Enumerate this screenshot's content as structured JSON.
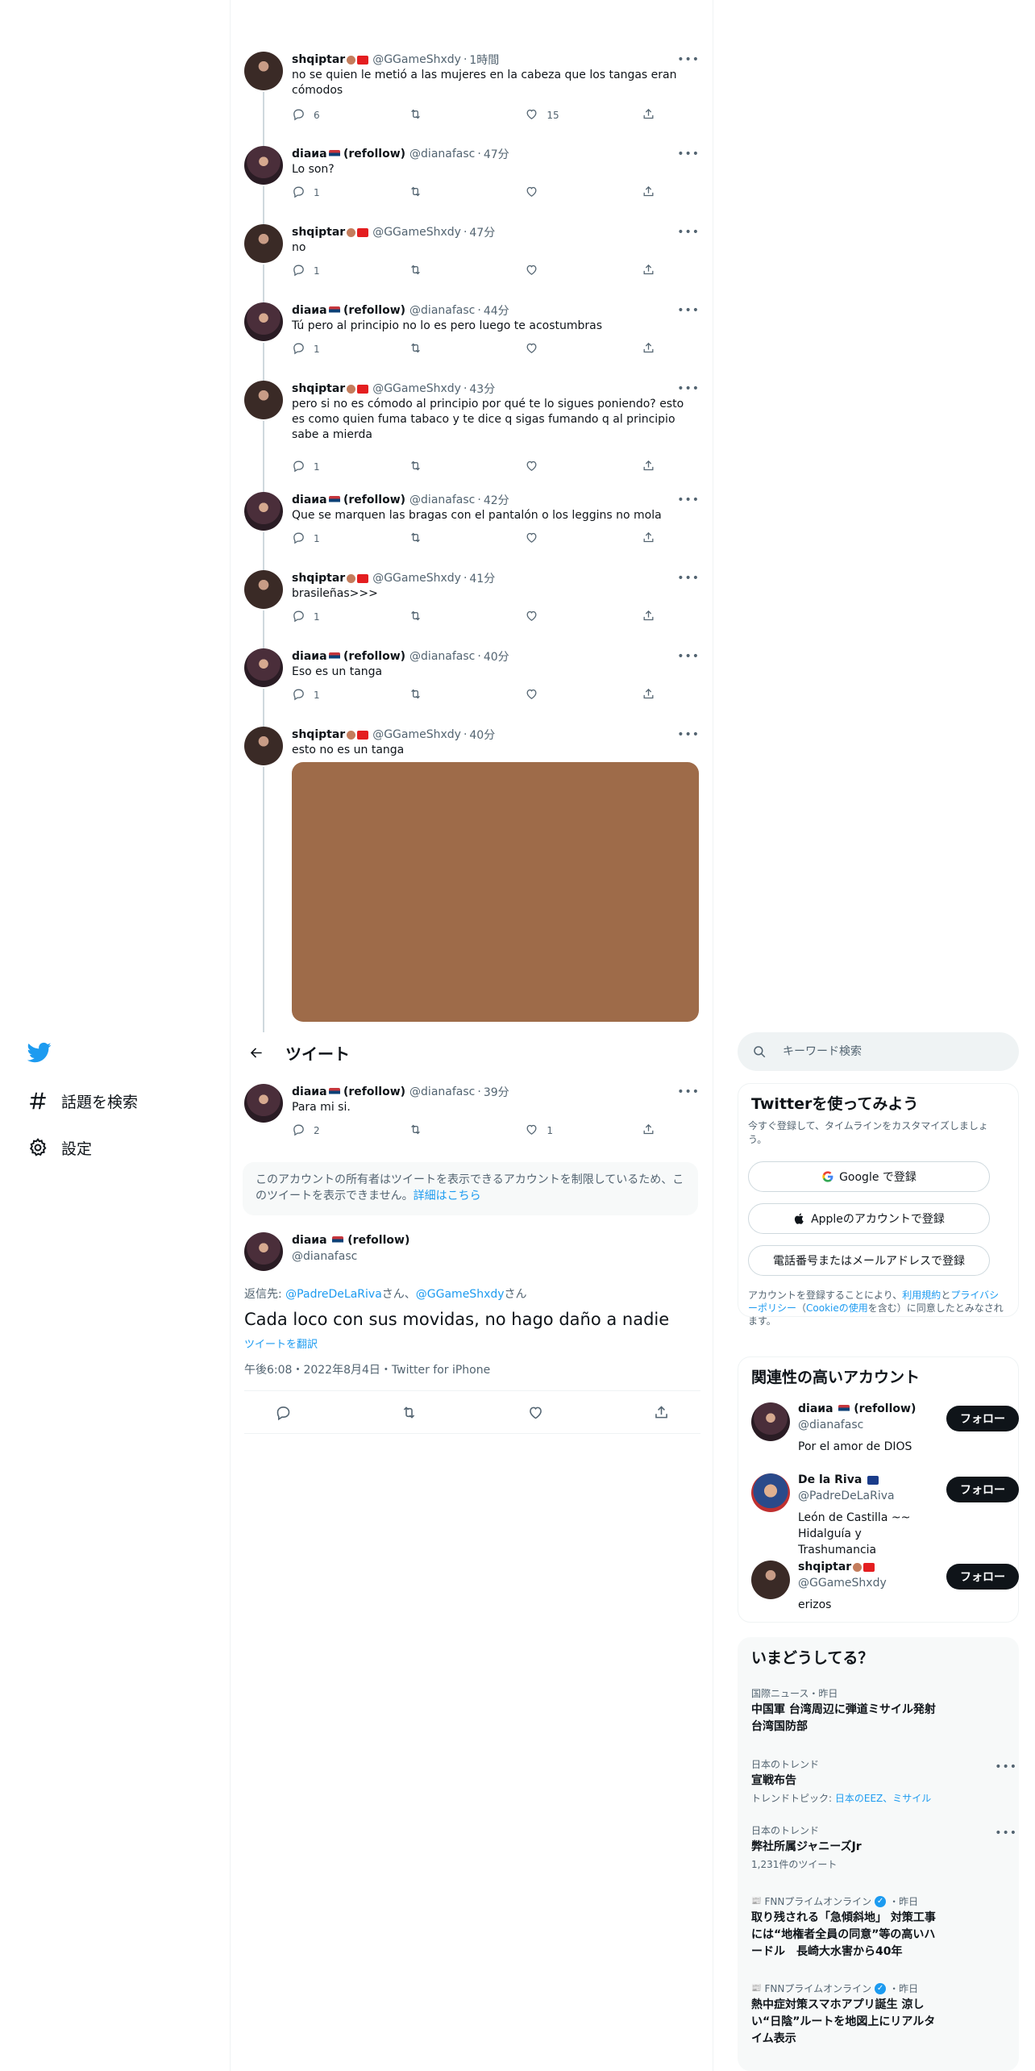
{
  "nav": {
    "items": [
      {
        "label": "話題を検索",
        "icon": "hashtag-icon"
      },
      {
        "label": "設定",
        "icon": "gear-icon"
      }
    ]
  },
  "header": {
    "title": "ツイート"
  },
  "thread": [
    {
      "name": "shqiptar",
      "handle": "@GGameShxdy",
      "time": "1時間",
      "text": "no se quien le metió a las mujeres en la cabeza que los tangas eran cómodos",
      "replies": "6",
      "retweets": "",
      "likes": "15"
    },
    {
      "name": "diaиa",
      "extra": "(refollow)",
      "handle": "@dianafasc",
      "time": "47分",
      "text": "Lo son?",
      "replies": "1",
      "retweets": "",
      "likes": ""
    },
    {
      "name": "shqiptar",
      "handle": "@GGameShxdy",
      "time": "47分",
      "text": "no",
      "replies": "1",
      "retweets": "",
      "likes": ""
    },
    {
      "name": "diaиa",
      "extra": "(refollow)",
      "handle": "@dianafasc",
      "time": "44分",
      "text": "Tú pero al principio no lo es pero luego te acostumbras",
      "replies": "1",
      "retweets": "",
      "likes": ""
    },
    {
      "name": "shqiptar",
      "handle": "@GGameShxdy",
      "time": "43分",
      "text": "pero si no es cómodo al principio por qué te lo sigues poniendo? esto es como quien fuma tabaco y te dice q sigas fumando q al principio sabe a mierda",
      "replies": "1",
      "retweets": "",
      "likes": ""
    },
    {
      "name": "diaиa",
      "extra": "(refollow)",
      "handle": "@dianafasc",
      "time": "42分",
      "text": "Que se marquen las bragas con el pantalón o los leggins no mola",
      "replies": "1",
      "retweets": "",
      "likes": ""
    },
    {
      "name": "shqiptar",
      "handle": "@GGameShxdy",
      "time": "41分",
      "text": "brasileñas>>>",
      "replies": "1",
      "retweets": "",
      "likes": ""
    },
    {
      "name": "diaиa",
      "extra": "(refollow)",
      "handle": "@dianafasc",
      "time": "40分",
      "text": "Eso es un tanga",
      "replies": "1",
      "retweets": "",
      "likes": ""
    },
    {
      "name": "shqiptar",
      "handle": "@GGameShxdy",
      "time": "40分",
      "text": "esto no es un tanga"
    },
    {
      "name": "diaиa",
      "extra": "(refollow)",
      "handle": "@dianafasc",
      "time": "39分",
      "text": "Para mi si.",
      "replies": "2",
      "retweets": "",
      "likes": "1"
    }
  ],
  "restricted": {
    "text": "このアカウントの所有者はツイートを表示できるアカウントを制限しているため、このツイートを表示できません。",
    "link": "詳細はこちら"
  },
  "main_tweet": {
    "name": "diaиa",
    "extra": "(refollow)",
    "handle": "@dianafasc",
    "reply_prefix": "返信先: ",
    "reply_to_1": "@PadreDeLaRiva",
    "reply_suffix_1": "さん、",
    "reply_to_2": "@GGameShxdy",
    "reply_suffix_2": "さん",
    "text": "Cada loco con sus movidas, no hago daño a nadie",
    "translate": "ツイートを翻訳",
    "time": "午後6:08",
    "date": "2022年8月4日",
    "source": "Twitter for iPhone",
    "sep": "・"
  },
  "search": {
    "placeholder": "キーワード検索"
  },
  "signup": {
    "title": "Twitterを使ってみよう",
    "subtitle": "今すぐ登録して、タイムラインをカスタマイズしましょう。",
    "google": "Google で登録",
    "apple": "Appleのアカウントで登録",
    "phone": "電話番号またはメールアドレスで登録",
    "terms_1": "アカウントを登録することにより、",
    "terms_link_1": "利用規約",
    "terms_2": "と",
    "terms_link_2": "プライバシーポリシー",
    "terms_3": "（",
    "terms_link_3": "Cookieの使用",
    "terms_4": "を含む）に同意したとみなされます。"
  },
  "related": {
    "title": "関連性の高いアカウント",
    "follow_label": "フォロー",
    "accounts": [
      {
        "name": "diaиa",
        "extra": "(refollow)",
        "handle": "@dianafasc",
        "bio": "Por el amor de DIOS"
      },
      {
        "name": "De la Riva",
        "handle": "@PadreDeLaRiva",
        "bio": "León de Castilla ~~ Hidalguía y Trashumancia"
      },
      {
        "name": "shqiptar",
        "handle": "@GGameShxdy",
        "bio": "erizos"
      }
    ]
  },
  "trends": {
    "title": "いまどうしてる？",
    "items": [
      {
        "meta": "国際ニュース・昨日",
        "title": "中国軍 台湾周辺に弾道ミサイル発射 台湾国防部"
      },
      {
        "meta": "日本のトレンド",
        "title": "宣戦布告",
        "sub_prefix": "トレンドトピック: ",
        "sub_link": "日本のEEZ、ミサイル"
      },
      {
        "meta": "日本のトレンド",
        "title": "弊社所属ジャニーズJr",
        "sub": "1,231件のツイート"
      },
      {
        "meta": "FNNプライムオンライン",
        "meta_time": "・昨日",
        "title": "取り残される「急傾斜地」 対策工事には“地権者全員の同意”等の高いハードル　長崎大水害から40年"
      },
      {
        "meta": "FNNプライムオンライン",
        "meta_time": "・昨日",
        "title": "熱中症対策スマホアプリ誕生 涼しい“日陰”ルートを地図上にリアルタイム表示"
      }
    ]
  },
  "colors": {
    "accent": "#1d9bf0",
    "text": "#0f1419",
    "muted": "#536471",
    "media": "#9e6b49"
  }
}
